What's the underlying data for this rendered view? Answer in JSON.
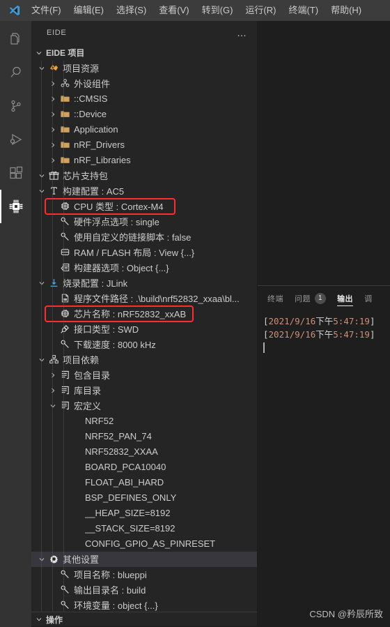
{
  "window": {
    "menu": [
      {
        "label": "文件(F)"
      },
      {
        "label": "编辑(E)"
      },
      {
        "label": "选择(S)"
      },
      {
        "label": "查看(V)"
      },
      {
        "label": "转到(G)"
      },
      {
        "label": "运行(R)"
      },
      {
        "label": "终端(T)"
      },
      {
        "label": "帮助(H)"
      }
    ]
  },
  "activitybar": {
    "items": [
      {
        "name": "explorer-icon",
        "title": "资源管理器"
      },
      {
        "name": "search-icon",
        "title": "搜索"
      },
      {
        "name": "source-control-icon",
        "title": "源代码管理"
      },
      {
        "name": "run-debug-icon",
        "title": "运行和调试"
      },
      {
        "name": "extensions-icon",
        "title": "扩展"
      },
      {
        "name": "chip-icon",
        "title": "EIDE"
      }
    ],
    "active_index": 5
  },
  "sidebar": {
    "title": "EIDE",
    "more_actions": "…",
    "section_project": "EIDE 项目",
    "section_operations": "操作",
    "tree": [
      {
        "depth": 1,
        "twisty": "down",
        "icon": "project-resource-icon",
        "label": "项目资源"
      },
      {
        "depth": 2,
        "twisty": "right",
        "icon": "components-icon",
        "label": "外设组件"
      },
      {
        "depth": 2,
        "twisty": "right",
        "icon": "folder-icon",
        "label": "::CMSIS"
      },
      {
        "depth": 2,
        "twisty": "right",
        "icon": "folder-icon",
        "label": "::Device"
      },
      {
        "depth": 2,
        "twisty": "right",
        "icon": "folder-icon",
        "label": "Application"
      },
      {
        "depth": 2,
        "twisty": "right",
        "icon": "folder-icon",
        "label": "nRF_Drivers"
      },
      {
        "depth": 2,
        "twisty": "right",
        "icon": "folder-icon",
        "label": "nRF_Libraries"
      },
      {
        "depth": 1,
        "twisty": "down",
        "icon": "gift-icon",
        "label": "芯片支持包"
      },
      {
        "depth": 1,
        "twisty": "down",
        "icon": "tool-icon",
        "label": "构建配置 : AC5"
      },
      {
        "depth": 2,
        "twisty": "none",
        "icon": "chip-icon",
        "label": "CPU 类型 : Cortex-M4",
        "highlight": true
      },
      {
        "depth": 2,
        "twisty": "none",
        "icon": "wrench-icon",
        "label": "硬件浮点选项 : single"
      },
      {
        "depth": 2,
        "twisty": "none",
        "icon": "wrench-icon",
        "label": "使用自定义的链接脚本 : false"
      },
      {
        "depth": 2,
        "twisty": "none",
        "icon": "memory-icon",
        "label": "RAM / FLASH 布局 : View {...}"
      },
      {
        "depth": 2,
        "twisty": "none",
        "icon": "builder-icon",
        "label": "构建器选项 : Object {...}"
      },
      {
        "depth": 1,
        "twisty": "down",
        "icon": "download-icon",
        "label": "烧录配置 : JLink"
      },
      {
        "depth": 2,
        "twisty": "none",
        "icon": "binary-file-icon",
        "label": "程序文件路径 : .\\build\\nrf52832_xxaa\\bl..."
      },
      {
        "depth": 2,
        "twisty": "none",
        "icon": "chip-icon",
        "label": "芯片名称 : nRF52832_xxAB",
        "highlight": true
      },
      {
        "depth": 2,
        "twisty": "none",
        "icon": "plug-icon",
        "label": "接口类型 : SWD"
      },
      {
        "depth": 2,
        "twisty": "none",
        "icon": "wrench-icon",
        "label": "下载速度 : 8000 kHz"
      },
      {
        "depth": 1,
        "twisty": "down",
        "icon": "dependency-icon",
        "label": "项目依赖"
      },
      {
        "depth": 2,
        "twisty": "right",
        "icon": "list-icon",
        "label": "包含目录"
      },
      {
        "depth": 2,
        "twisty": "right",
        "icon": "list-icon",
        "label": "库目录"
      },
      {
        "depth": 2,
        "twisty": "down",
        "icon": "list-icon",
        "label": "宏定义"
      },
      {
        "depth": 3,
        "twisty": "none",
        "icon": "none",
        "label": "NRF52"
      },
      {
        "depth": 3,
        "twisty": "none",
        "icon": "none",
        "label": "NRF52_PAN_74"
      },
      {
        "depth": 3,
        "twisty": "none",
        "icon": "none",
        "label": "NRF52832_XXAA"
      },
      {
        "depth": 3,
        "twisty": "none",
        "icon": "none",
        "label": "BOARD_PCA10040"
      },
      {
        "depth": 3,
        "twisty": "none",
        "icon": "none",
        "label": "FLOAT_ABI_HARD"
      },
      {
        "depth": 3,
        "twisty": "none",
        "icon": "none",
        "label": "BSP_DEFINES_ONLY"
      },
      {
        "depth": 3,
        "twisty": "none",
        "icon": "none",
        "label": "__HEAP_SIZE=8192"
      },
      {
        "depth": 3,
        "twisty": "none",
        "icon": "none",
        "label": "__STACK_SIZE=8192"
      },
      {
        "depth": 3,
        "twisty": "none",
        "icon": "none",
        "label": "CONFIG_GPIO_AS_PINRESET"
      },
      {
        "depth": 1,
        "twisty": "down",
        "icon": "gear-icon",
        "label": "其他设置",
        "selected": true
      },
      {
        "depth": 2,
        "twisty": "none",
        "icon": "wrench-icon",
        "label": "项目名称 : blueppi"
      },
      {
        "depth": 2,
        "twisty": "none",
        "icon": "wrench-icon",
        "label": "输出目录名 : build"
      },
      {
        "depth": 2,
        "twisty": "none",
        "icon": "wrench-icon",
        "label": "环境变量 : object {...}"
      }
    ]
  },
  "panel": {
    "tabs": [
      {
        "label": "终端",
        "active": false,
        "badge": ""
      },
      {
        "label": "问题",
        "active": false,
        "badge": "1"
      },
      {
        "label": "输出",
        "active": true,
        "badge": ""
      },
      {
        "label": "调",
        "active": false,
        "badge": ""
      }
    ],
    "lines": [
      {
        "bracket_open": "[",
        "date": "2021/9/16",
        "ampm": "下午",
        "time": "5:47:19",
        "bracket_close": "]"
      },
      {
        "bracket_open": "[",
        "date": "2021/9/16",
        "ampm": "下午",
        "time": "5:47:19",
        "bracket_close": "]"
      }
    ]
  },
  "watermark": "CSDN @矜辰所致",
  "colors": {
    "accent_red": "#ff2d2d",
    "folder": "#c09553",
    "sidebar_bg": "#252526",
    "editor_bg": "#1e1e1e",
    "menubar_bg": "#3c3c3c",
    "activitybar_bg": "#333333",
    "text": "#cccccc",
    "timestamp": "#ce9178"
  }
}
